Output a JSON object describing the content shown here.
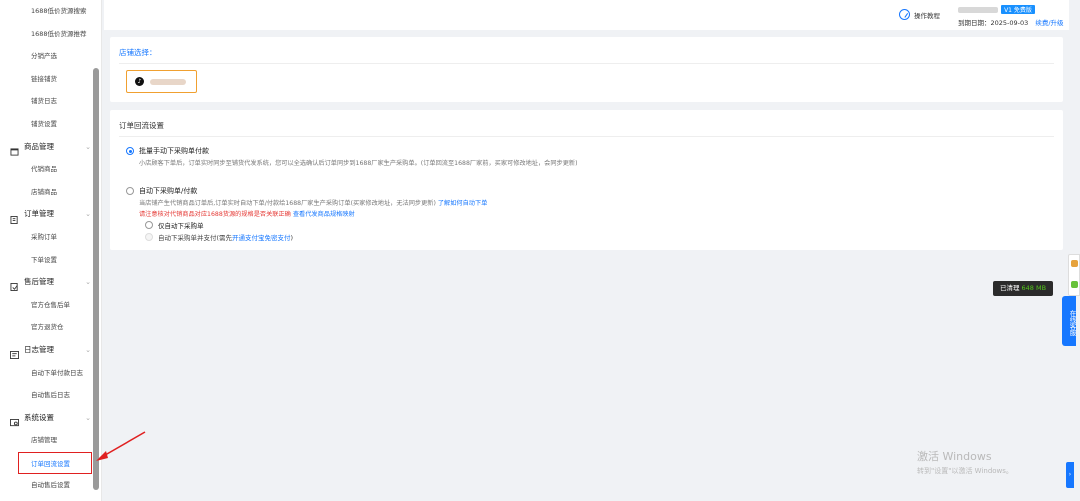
{
  "sidebar": {
    "items": [
      {
        "type": "sub",
        "label": "1688低价货源搜索"
      },
      {
        "type": "sub",
        "label": "1688低价货源推荐"
      },
      {
        "type": "sub",
        "label": "分销产选"
      },
      {
        "type": "sub",
        "label": "链接铺货"
      },
      {
        "type": "sub",
        "label": "铺货日志"
      },
      {
        "type": "sub",
        "label": "铺货设置"
      },
      {
        "type": "group",
        "label": "商品管理",
        "icon": "box-icon"
      },
      {
        "type": "sub",
        "label": "代销商品"
      },
      {
        "type": "sub",
        "label": "店铺商品"
      },
      {
        "type": "group",
        "label": "订单管理",
        "icon": "order-icon"
      },
      {
        "type": "sub",
        "label": "采购订单"
      },
      {
        "type": "sub",
        "label": "下单设置"
      },
      {
        "type": "group",
        "label": "售后管理",
        "icon": "aftersale-icon"
      },
      {
        "type": "sub",
        "label": "官方仓售后单"
      },
      {
        "type": "sub",
        "label": "官方退货仓"
      },
      {
        "type": "group",
        "label": "日志管理",
        "icon": "log-icon"
      },
      {
        "type": "sub",
        "label": "自动下单付款日志"
      },
      {
        "type": "sub",
        "label": "自动售后日志"
      },
      {
        "type": "group",
        "label": "系统设置",
        "icon": "settings-icon"
      },
      {
        "type": "sub",
        "label": "店铺管理"
      },
      {
        "type": "sub",
        "label": "订单回流设置",
        "active": true
      },
      {
        "type": "sub",
        "label": "自动售后设置"
      }
    ]
  },
  "topbar": {
    "help_label": "操作教程",
    "version_badge": "V1 免费版",
    "expiry_label": "到期日期：",
    "expiry_date": "2025-09-03",
    "renew_link": "续费/升级"
  },
  "shop_panel": {
    "title": "店铺选择：",
    "platform_icon": "tiktok-icon"
  },
  "order_panel": {
    "title": "订单回流设置",
    "option1": {
      "label": "批量手动下采购单付款",
      "desc": "小店顾客下单后，订单实时同步至铺货代发系统，您可以全选确认后订单同步到1688厂家生产采购单。(订单回流至1688厂家前，买家可修改地址，会同步更新)",
      "selected": true
    },
    "option2": {
      "label": "自动下采购单/付款",
      "desc": "当店铺产生代销商品订单后,订单实时自动下单/付款给1688厂家生产采购订单(买家修改地址，无法同步更新)",
      "desc_link": "了解如何自动下单",
      "warning": "请注意核对代销商品对应1688货源的规格是否关联正确",
      "warning_link": "查看代发商品规格映射",
      "selected": false
    },
    "sub1": {
      "label": "仅自动下采购单"
    },
    "sub2": {
      "label": "自动下采购单并支付(需先",
      "link": "开通支付宝免密支付",
      "suffix": ")"
    }
  },
  "memory_tip": {
    "prefix": "已清理",
    "value": "648 MB"
  },
  "kefu_label": "在线客服",
  "watermark": {
    "line1": "激活 Windows",
    "line2": "转到\"设置\"以激活 Windows。"
  }
}
